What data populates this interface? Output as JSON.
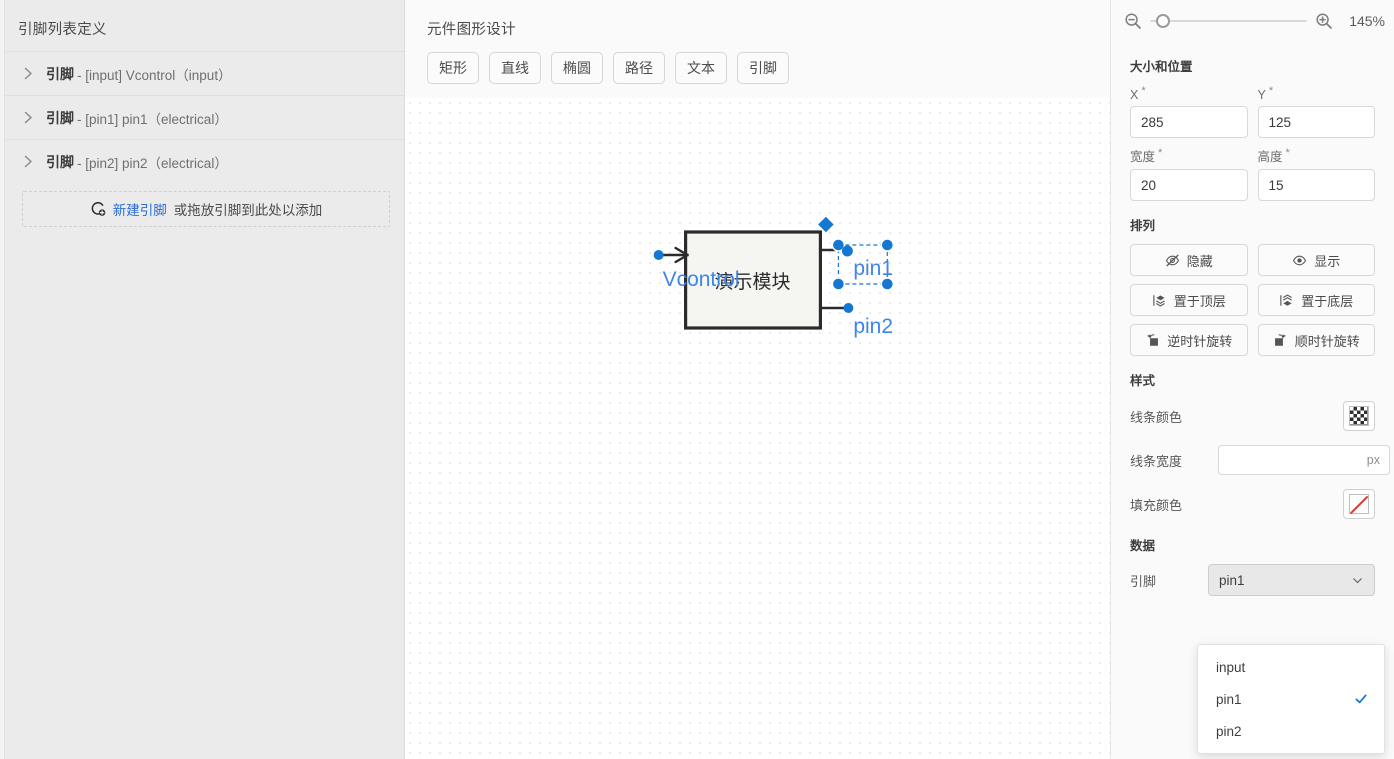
{
  "sidebar": {
    "title": "引脚列表定义",
    "rows": [
      {
        "strong": "引脚",
        "rest": "- [input] Vcontrol（input）",
        "chevron": "chevron-right-icon"
      },
      {
        "strong": "引脚",
        "rest": "- [pin1] pin1（electrical）",
        "chevron": "chevron-right-icon"
      },
      {
        "strong": "引脚",
        "rest": "- [pin2] pin2（electrical）",
        "chevron": "chevron-right-icon"
      }
    ],
    "add_row": {
      "icon": "add-pin-icon",
      "link_label": "新建引脚",
      "rest_label": "或拖放引脚到此处以添加"
    }
  },
  "canvas_panel": {
    "title": "元件图形设计",
    "tools": [
      {
        "label": "矩形",
        "name": "rectangle"
      },
      {
        "label": "直线",
        "name": "line"
      },
      {
        "label": "椭圆",
        "name": "ellipse"
      },
      {
        "label": "路径",
        "name": "path"
      },
      {
        "label": "文本",
        "name": "text"
      },
      {
        "label": "引脚",
        "name": "pin"
      }
    ],
    "shape": {
      "module_label": "演示模块",
      "pin_labels": [
        "Vcontrol",
        "pin1",
        "pin2"
      ],
      "selection_color": "#1677d2",
      "outline_color": "#2b2b2b",
      "fill_color": "#f5f5f2"
    }
  },
  "zoom": {
    "zoom_out_icon": "zoom-out-icon",
    "zoom_in_icon": "zoom-in-icon",
    "percent": "145%",
    "slider_value": 8
  },
  "properties": {
    "size_section_title": "大小和位置",
    "fields": [
      {
        "label": "X",
        "required": "*",
        "value": "285",
        "name": "x"
      },
      {
        "label": "Y",
        "required": "*",
        "value": "125",
        "name": "y"
      },
      {
        "label": "宽度",
        "required": "*",
        "value": "20",
        "name": "width"
      },
      {
        "label": "高度",
        "required": "*",
        "value": "15",
        "name": "height"
      }
    ],
    "arrange_section_title": "排列",
    "arrange_buttons": [
      {
        "label": "隐藏",
        "icon": "eye-off-icon",
        "name": "hide"
      },
      {
        "label": "显示",
        "icon": "eye-icon",
        "name": "show"
      },
      {
        "label": "置于顶层",
        "icon": "bring-to-front-icon",
        "name": "bring-to-front"
      },
      {
        "label": "置于底层",
        "icon": "send-to-back-icon",
        "name": "send-to-back"
      },
      {
        "label": "逆时针旋转",
        "icon": "rotate-ccw-icon",
        "name": "rotate-ccw"
      },
      {
        "label": "顺时针旋转",
        "icon": "rotate-cw-icon",
        "name": "rotate-cw"
      }
    ],
    "style_section_title": "样式",
    "style": {
      "line_color_label": "线条颜色",
      "line_color_swatch": "transparent-checker",
      "line_width_label": "线条宽度",
      "line_width_value": "",
      "line_width_unit": "px",
      "fill_color_label": "填充颜色",
      "fill_color_swatch": "none-red-slash"
    },
    "data_section_title": "数据",
    "data": {
      "pin_label": "引脚",
      "selected": "pin1",
      "options": [
        {
          "label": "input",
          "checked": false
        },
        {
          "label": "pin1",
          "checked": true
        },
        {
          "label": "pin2",
          "checked": false
        }
      ]
    }
  },
  "colors": {
    "accent": "#1677d2",
    "link": "#2a6dd4",
    "sidebar_bg": "#ebebeb",
    "panel_bg": "#fafafa",
    "canvas_bg": "#ffffff",
    "red_slash": "#d63b2f"
  }
}
